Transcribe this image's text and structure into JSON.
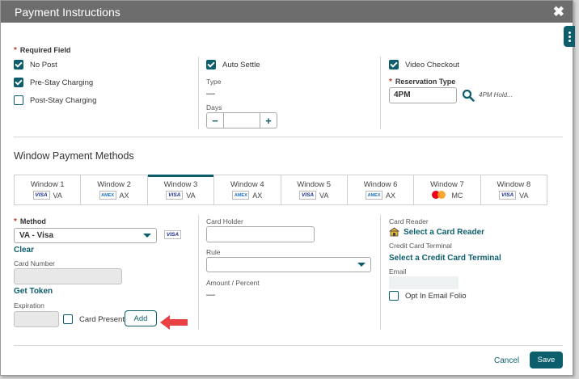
{
  "dialog": {
    "title": "Payment Instructions",
    "close": "✖"
  },
  "required_field": "Required Field",
  "col1": {
    "no_post": {
      "label": "No Post",
      "checked": true
    },
    "pre_stay": {
      "label": "Pre-Stay Charging",
      "checked": true
    },
    "post_stay": {
      "label": "Post-Stay Charging",
      "checked": false
    }
  },
  "col2": {
    "auto_settle": {
      "label": "Auto Settle",
      "checked": true
    },
    "type_label": "Type",
    "type_value": "—",
    "days_label": "Days",
    "days_value": "",
    "minus": "−",
    "plus": "+"
  },
  "col3": {
    "video_checkout": {
      "label": "Video Checkout",
      "checked": true
    },
    "reservation_type_label": "Reservation Type",
    "reservation_type_value": "4PM",
    "reservation_type_desc": "4PM Hold..."
  },
  "window_methods": {
    "title": "Window Payment Methods",
    "tabs": [
      {
        "label": "Window 1",
        "card": "VISA",
        "code": "VA",
        "type": "visa",
        "active": false
      },
      {
        "label": "Window 2",
        "card": "AMEX",
        "code": "AX",
        "type": "amex",
        "active": false
      },
      {
        "label": "Window 3",
        "card": "VISA",
        "code": "VA",
        "type": "visa",
        "active": true
      },
      {
        "label": "Window 4",
        "card": "AMEX",
        "code": "AX",
        "type": "amex",
        "active": false
      },
      {
        "label": "Window 5",
        "card": "VISA",
        "code": "VA",
        "type": "visa",
        "active": false
      },
      {
        "label": "Window 6",
        "card": "AMEX",
        "code": "AX",
        "type": "amex",
        "active": false
      },
      {
        "label": "Window 7",
        "card": "",
        "code": "MC",
        "type": "mc",
        "active": false
      },
      {
        "label": "Window 8",
        "card": "VISA",
        "code": "VA",
        "type": "visa",
        "active": false
      }
    ]
  },
  "method": {
    "label": "Method",
    "value": "VA - Visa",
    "logo": "VISA",
    "clear": "Clear",
    "card_number_label": "Card Number",
    "get_token": "Get Token",
    "expiration_label": "Expiration",
    "card_present": {
      "label": "Card Present",
      "checked": false
    },
    "add": "Add"
  },
  "holder": {
    "card_holder_label": "Card Holder",
    "rule_label": "Rule",
    "amount_label": "Amount / Percent",
    "amount_value": "—"
  },
  "reader": {
    "card_reader_label": "Card Reader",
    "select_reader": "Select a Card Reader",
    "terminal_label": "Credit Card Terminal",
    "select_terminal": "Select a Credit Card Terminal",
    "email_label": "Email",
    "opt_in": {
      "label": "Opt In Email Folio",
      "checked": false
    }
  },
  "footer": {
    "cancel": "Cancel",
    "save": "Save"
  },
  "colors": {
    "accent": "#0d5e6c",
    "title_bar": "#6d6d6d",
    "arrow": "#e84141"
  }
}
